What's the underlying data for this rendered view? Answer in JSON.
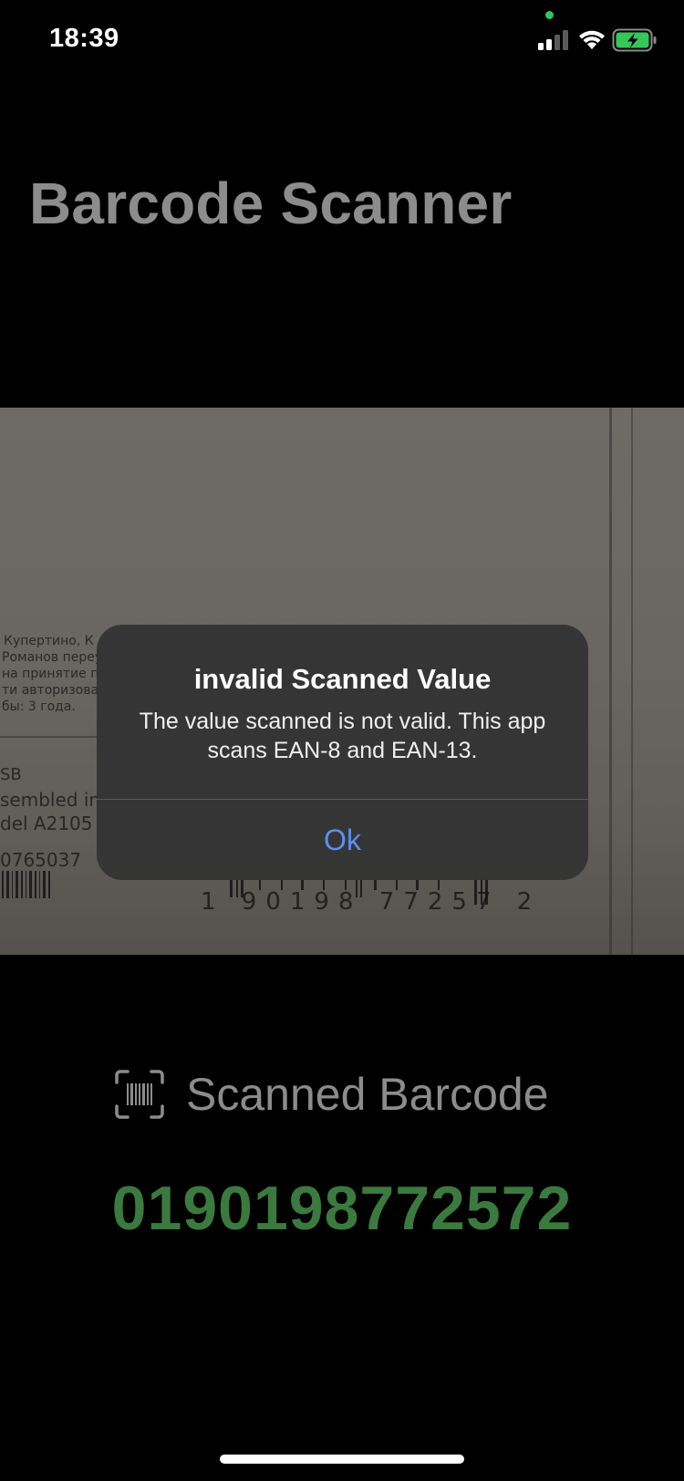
{
  "status_bar": {
    "time": "18:39",
    "battery_color": "#34c759",
    "privacy_dot_color": "#34c759"
  },
  "header": {
    "title": "Barcode Scanner"
  },
  "camera_preview": {
    "background_text_lines": [
      "Купертино, К",
      "Романов переу",
      "на принятие п",
      "ти авторизова",
      "бы: 3 года.",
      "SB",
      "sembled in",
      "del A2105",
      "0765037"
    ],
    "barcode_digits": "1 90198 77257 2"
  },
  "alert": {
    "title": "invalid Scanned Value",
    "message": "The value scanned is not valid. This app scans EAN-8 and EAN-13.",
    "button_label": "Ok",
    "button_color": "#5b8ff0"
  },
  "scanned": {
    "icon": "barcode-viewfinder-icon",
    "label": "Scanned Barcode",
    "value": "0190198772572",
    "value_color": "#3b7a3e"
  }
}
